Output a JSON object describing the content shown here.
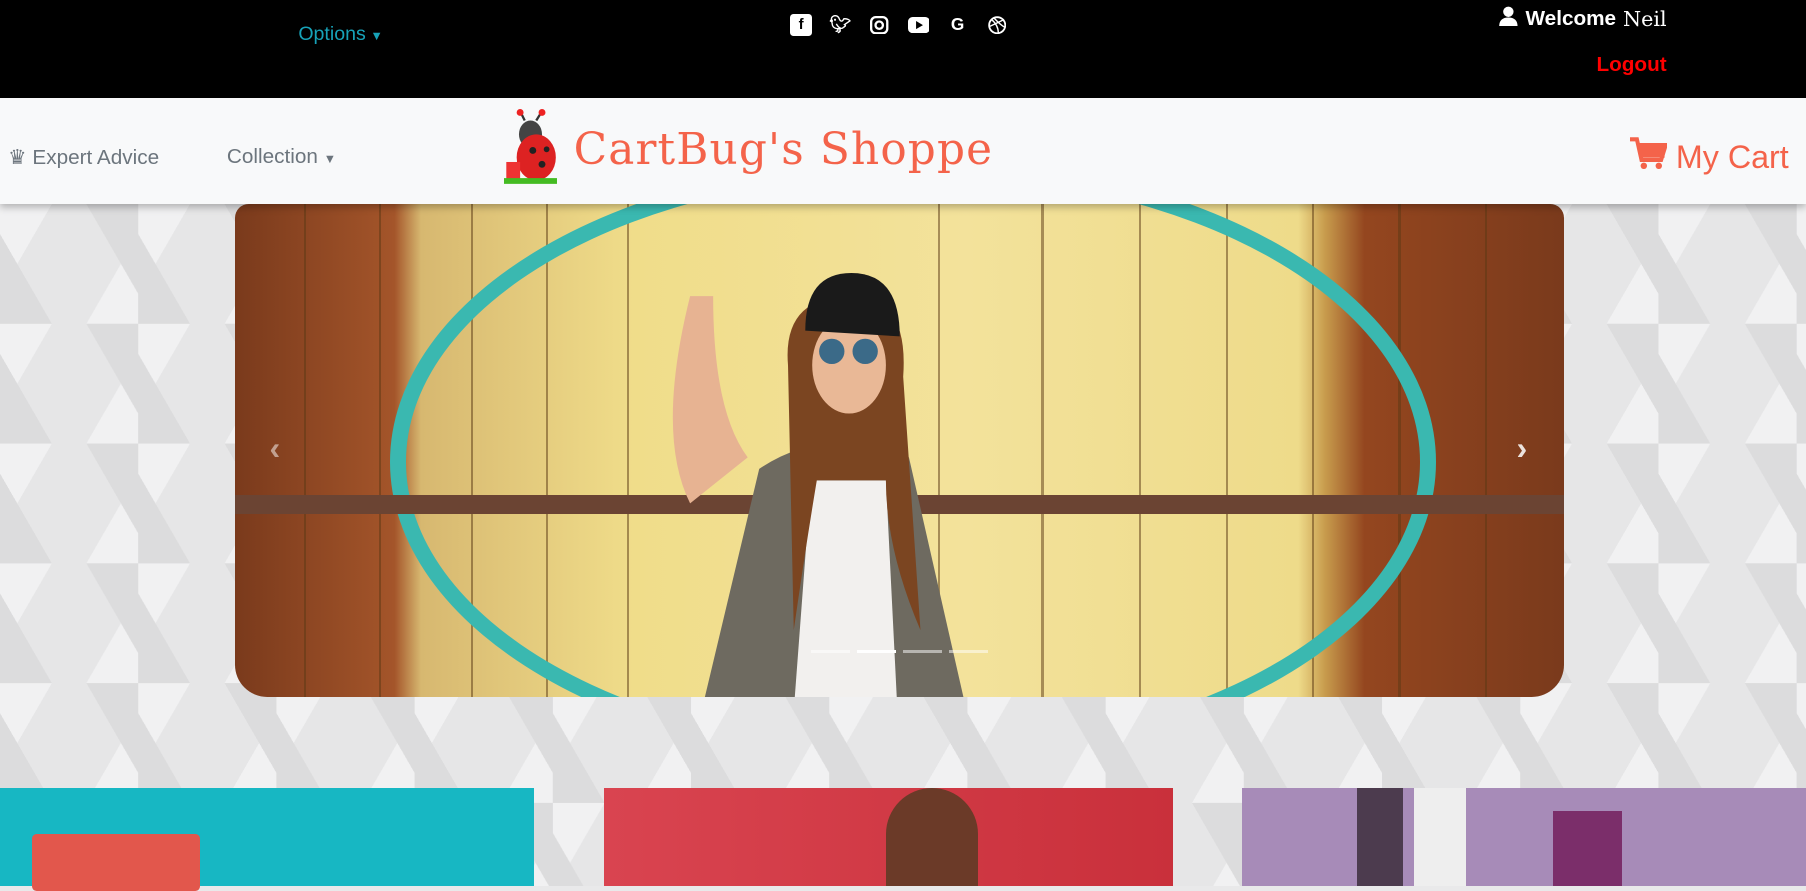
{
  "topbar": {
    "options_label": "Options",
    "welcome_label": "Welcome",
    "user_name": "Neil",
    "logout_label": "Logout",
    "social_icons": [
      "facebook-icon",
      "twitter-icon",
      "instagram-icon",
      "youtube-icon",
      "google-icon",
      "dribbble-icon"
    ]
  },
  "navbar": {
    "expert_advice_label": "Expert Advice",
    "collection_label": "Collection",
    "brand_name": "CartBug's Shoppe",
    "cart_label": "My Cart"
  },
  "carousel": {
    "slide_count": 4,
    "active_slide": 2
  },
  "colors": {
    "accent": "#f4634a",
    "options": "#17a2b8",
    "logout": "#ff0000"
  }
}
